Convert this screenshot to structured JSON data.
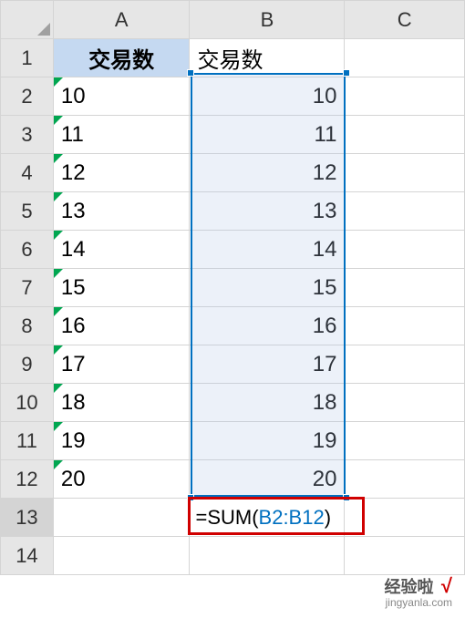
{
  "columns": [
    "A",
    "B",
    "C"
  ],
  "rows": [
    "1",
    "2",
    "3",
    "4",
    "5",
    "6",
    "7",
    "8",
    "9",
    "10",
    "11",
    "12",
    "13",
    "14"
  ],
  "headers": {
    "a": "交易数",
    "b": "交易数"
  },
  "col_a_values": [
    "10",
    "11",
    "12",
    "13",
    "14",
    "15",
    "16",
    "17",
    "18",
    "19",
    "20"
  ],
  "col_b_values": [
    "10",
    "11",
    "12",
    "13",
    "14",
    "15",
    "16",
    "17",
    "18",
    "19",
    "20"
  ],
  "formula": {
    "prefix": "=SUM(",
    "range": "B2:B12",
    "suffix": ")"
  },
  "watermark": {
    "title": "经验啦",
    "check": "√",
    "url": "jingyanla.com"
  }
}
